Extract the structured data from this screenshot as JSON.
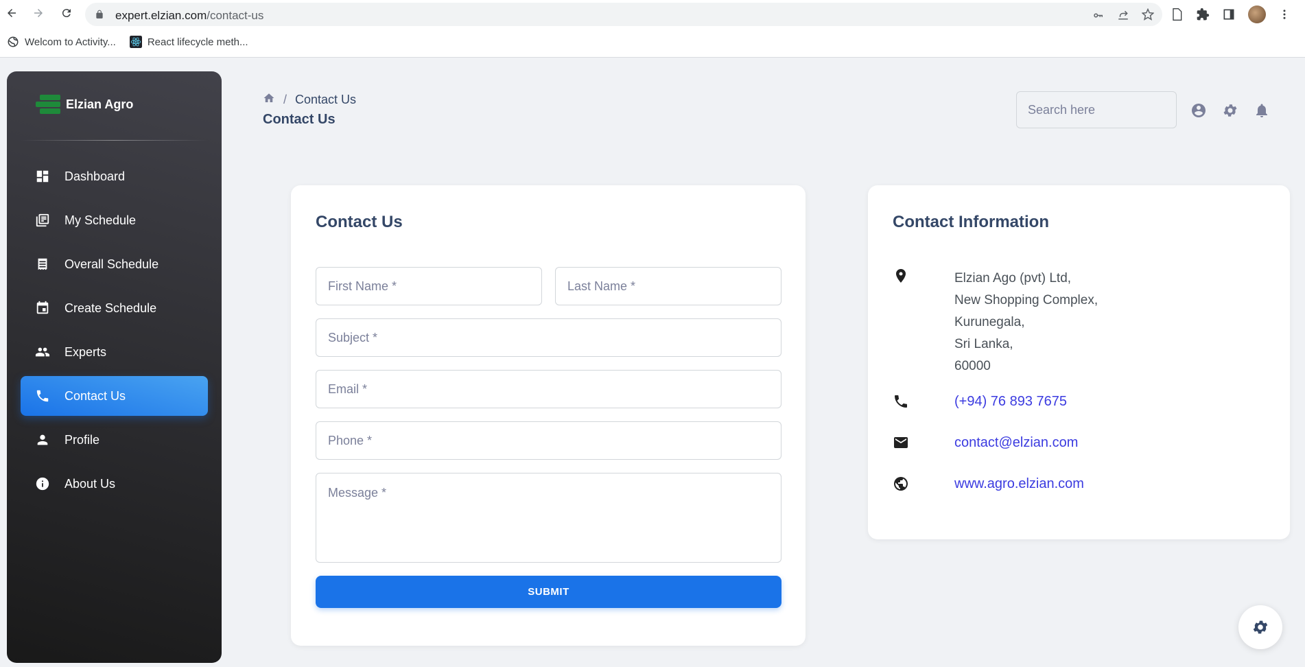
{
  "browser": {
    "url_host": "expert.elzian.com",
    "url_path": "/contact-us",
    "bookmarks": [
      {
        "label": "Welcom to Activity...",
        "icon": "globe-icon"
      },
      {
        "label": "React lifecycle meth...",
        "icon": "react-icon"
      }
    ]
  },
  "sidebar": {
    "brand": "Elzian Agro",
    "items": [
      {
        "label": "Dashboard",
        "icon": "dashboard-icon",
        "active": false
      },
      {
        "label": "My Schedule",
        "icon": "schedule-icon",
        "active": false
      },
      {
        "label": "Overall Schedule",
        "icon": "receipt-icon",
        "active": false
      },
      {
        "label": "Create Schedule",
        "icon": "calendar-icon",
        "active": false
      },
      {
        "label": "Experts",
        "icon": "people-icon",
        "active": false
      },
      {
        "label": "Contact Us",
        "icon": "phone-icon",
        "active": true
      },
      {
        "label": "Profile",
        "icon": "person-icon",
        "active": false
      },
      {
        "label": "About Us",
        "icon": "info-icon",
        "active": false
      }
    ]
  },
  "navbar": {
    "breadcrumb_current": "Contact Us",
    "page_title": "Contact Us",
    "search_placeholder": "Search here"
  },
  "form": {
    "title": "Contact Us",
    "first_name_placeholder": "First Name *",
    "last_name_placeholder": "Last Name *",
    "subject_placeholder": "Subject *",
    "email_placeholder": "Email *",
    "phone_placeholder": "Phone *",
    "message_placeholder": "Message *",
    "submit_label": "SUBMIT"
  },
  "info": {
    "title": "Contact Information",
    "address_lines": [
      "Elzian Ago (pvt) Ltd,",
      "New Shopping Complex,",
      "Kurunegala,",
      "Sri Lanka,",
      "60000"
    ],
    "phone": "(+94) 76 893 7675",
    "email": "contact@elzian.com",
    "website": "www.agro.elzian.com"
  },
  "colors": {
    "accent": "#1a73e8",
    "sidebar_dark": "#191919",
    "link": "#3b3be0",
    "brand_green": "#1e8a3a"
  }
}
